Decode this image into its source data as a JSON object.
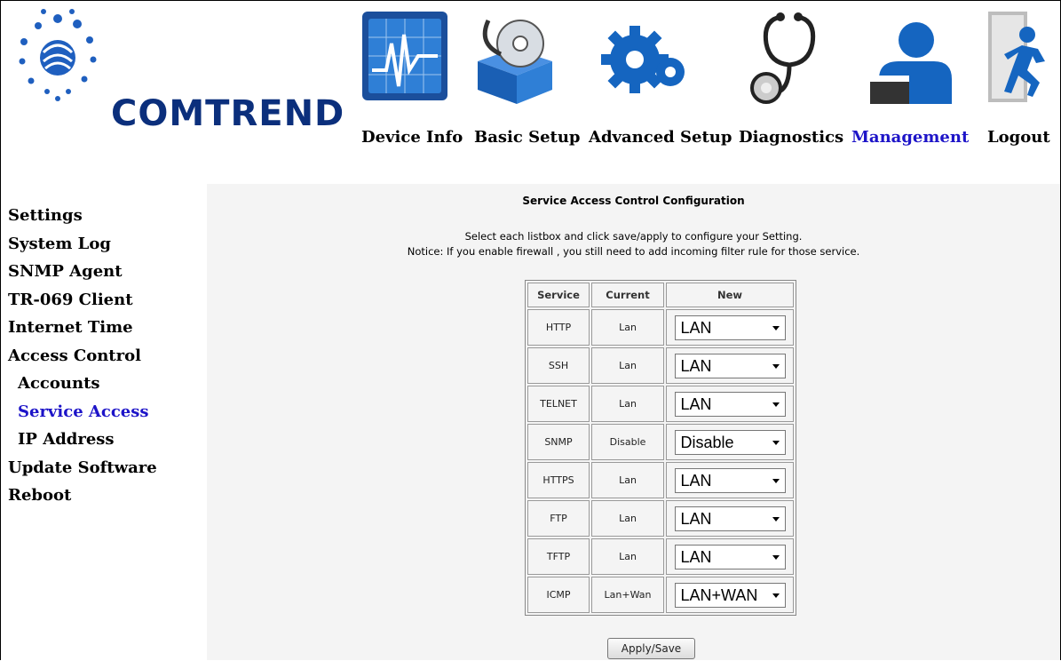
{
  "brand": {
    "logo_text": "COMTREND"
  },
  "nav": [
    {
      "label": "Device Info",
      "icon": "device-info-icon"
    },
    {
      "label": "Basic Setup",
      "icon": "basic-setup-icon"
    },
    {
      "label": "Advanced Setup",
      "icon": "advanced-setup-icon"
    },
    {
      "label": "Diagnostics",
      "icon": "diagnostics-icon"
    },
    {
      "label": "Management",
      "icon": "management-icon"
    },
    {
      "label": "Logout",
      "icon": "logout-icon"
    }
  ],
  "active_nav": "Management",
  "sidebar": [
    {
      "label": "Settings",
      "sub": false
    },
    {
      "label": "System Log",
      "sub": false
    },
    {
      "label": "SNMP Agent",
      "sub": false
    },
    {
      "label": "TR-069 Client",
      "sub": false
    },
    {
      "label": "Internet Time",
      "sub": false
    },
    {
      "label": "Access Control",
      "sub": false
    },
    {
      "label": "Accounts",
      "sub": true
    },
    {
      "label": "Service Access",
      "sub": true
    },
    {
      "label": "IP Address",
      "sub": true
    },
    {
      "label": "Update Software",
      "sub": false
    },
    {
      "label": "Reboot",
      "sub": false
    }
  ],
  "active_sidebar": "Service Access",
  "content": {
    "title": "Service Access Control Configuration",
    "desc1": "Select each listbox and click save/apply to configure your Setting.",
    "desc2": "Notice: If you enable firewall , you still need to add incoming filter rule for those service."
  },
  "table": {
    "headers": [
      "Service",
      "Current",
      "New"
    ],
    "rows": [
      {
        "service": "HTTP",
        "current": "Lan",
        "new": "LAN"
      },
      {
        "service": "SSH",
        "current": "Lan",
        "new": "LAN"
      },
      {
        "service": "TELNET",
        "current": "Lan",
        "new": "LAN"
      },
      {
        "service": "SNMP",
        "current": "Disable",
        "new": "Disable"
      },
      {
        "service": "HTTPS",
        "current": "Lan",
        "new": "LAN"
      },
      {
        "service": "FTP",
        "current": "Lan",
        "new": "LAN"
      },
      {
        "service": "TFTP",
        "current": "Lan",
        "new": "LAN"
      },
      {
        "service": "ICMP",
        "current": "Lan+Wan",
        "new": "LAN+WAN"
      }
    ]
  },
  "apply_label": "Apply/Save",
  "colors": {
    "active": "#1d14c8",
    "brand": "#0b2f7c",
    "content_bg": "#f4f4f4",
    "icon_blue": "#1565c0"
  }
}
